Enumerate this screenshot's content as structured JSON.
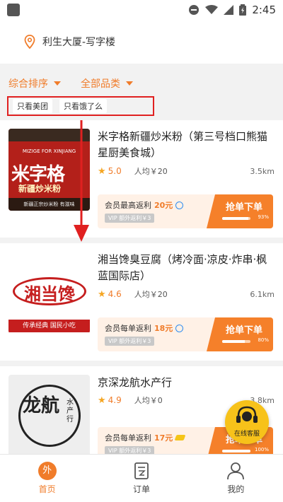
{
  "status_bar": {
    "time": "2:45"
  },
  "location": {
    "text": "利生大厦-写字楼"
  },
  "filters": {
    "sort_label": "综合排序",
    "category_label": "全部品类",
    "chips": [
      "只看美团",
      "只看饿了么"
    ]
  },
  "shops": [
    {
      "name": "米字格新疆炒米粉（第三号档口熊猫星厨美食城）",
      "rating": "5.0",
      "avg_price": "人均￥20",
      "distance": "3.5km",
      "rebate_label": "会员最高返利",
      "rebate_amount": "20元",
      "vip_text": "VIP 额外返利￥3",
      "button_label": "抢单下单",
      "progress_text": "93%",
      "progress_value": 0.93,
      "thumb_banner": "MIZIGE FOR XINJIANG",
      "thumb_title": "米字格",
      "thumb_sub": "新疆炒米粉",
      "thumb_foot": "新疆正宗炒米粉 有滋味"
    },
    {
      "name": "湘当馋臭豆腐（烤冷面·凉皮·炸串·枫蓝国际店）",
      "rating": "4.6",
      "avg_price": "人均￥20",
      "distance": "6.1km",
      "rebate_label": "会员每单返利",
      "rebate_amount": "18元",
      "vip_text": "VIP 额外返利￥3",
      "button_label": "抢单下单",
      "progress_text": "80%",
      "progress_value": 0.8,
      "thumb_title": "湘当馋",
      "thumb_foot": "传承经典 国民小吃"
    },
    {
      "name": "京深龙航水产行",
      "rating": "4.9",
      "avg_price": "人均￥0",
      "distance": "3.8km",
      "rebate_label": "会员每单返利",
      "rebate_amount": "17元",
      "vip_text": "VIP 额外返利￥3",
      "button_label": "抢单下单",
      "progress_text": "100%",
      "progress_value": 1.0,
      "thumb_title": "龙航",
      "thumb_side": "水产行"
    }
  ],
  "fab": {
    "label": "在线客服"
  },
  "tabbar": {
    "items": [
      {
        "label": "首页",
        "icon_char": "外",
        "active": true
      },
      {
        "label": "订单"
      },
      {
        "label": "我的"
      }
    ]
  },
  "colors": {
    "accent": "#f07c2a",
    "annotation": "#e02020",
    "fab": "#f7c21a"
  }
}
